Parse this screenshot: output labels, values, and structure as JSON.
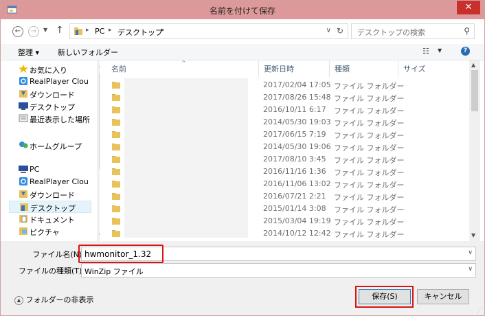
{
  "window": {
    "title": "名前を付けて保存",
    "close": "✕"
  },
  "address": {
    "root": "PC",
    "current": "デスクトップ"
  },
  "search": {
    "placeholder": "デスクトップの検索"
  },
  "toolbar": {
    "organize": "整理 ▾",
    "new_folder": "新しいフォルダー"
  },
  "nav": {
    "items": [
      {
        "label": "お気に入り",
        "icon": "star-icon"
      },
      {
        "label": "RealPlayer Clou",
        "icon": "realplayer-icon"
      },
      {
        "label": "ダウンロード",
        "icon": "download-icon"
      },
      {
        "label": "デスクトップ",
        "icon": "desktop-icon"
      },
      {
        "label": "最近表示した場所",
        "icon": "recent-icon"
      },
      {
        "label": "ホームグループ",
        "icon": "homegroup-icon"
      },
      {
        "label": "PC",
        "icon": "pc-icon"
      },
      {
        "label": "RealPlayer Clou",
        "icon": "realplayer-icon"
      },
      {
        "label": "ダウンロード",
        "icon": "download-icon"
      },
      {
        "label": "デスクトップ",
        "icon": "desktop-icon"
      },
      {
        "label": "ドキュメント",
        "icon": "document-icon"
      },
      {
        "label": "ピクチャ",
        "icon": "picture-icon"
      }
    ]
  },
  "columns": {
    "name": "名前",
    "date": "更新日時",
    "type": "種類",
    "size": "サイズ"
  },
  "files": [
    {
      "date": "2017/02/04 17:05",
      "type": "ファイル フォルダー"
    },
    {
      "date": "2017/08/26 15:48",
      "type": "ファイル フォルダー"
    },
    {
      "date": "2016/10/11 6:17",
      "type": "ファイル フォルダー"
    },
    {
      "date": "2014/05/30 19:03",
      "type": "ファイル フォルダー"
    },
    {
      "date": "2017/06/15 7:19",
      "type": "ファイル フォルダー"
    },
    {
      "date": "2014/05/30 19:06",
      "type": "ファイル フォルダー"
    },
    {
      "date": "2017/08/10 3:45",
      "type": "ファイル フォルダー"
    },
    {
      "date": "2016/11/16 1:36",
      "type": "ファイル フォルダー"
    },
    {
      "date": "2016/11/06 13:02",
      "type": "ファイル フォルダー"
    },
    {
      "date": "2016/07/21 2:21",
      "type": "ファイル フォルダー"
    },
    {
      "date": "2015/01/14 3:08",
      "type": "ファイル フォルダー"
    },
    {
      "date": "2015/03/04 19:19",
      "type": "ファイル フォルダー"
    },
    {
      "date": "2014/10/12 12:42",
      "type": "ファイル フォルダー"
    }
  ],
  "form": {
    "filename_label": "ファイル名(N):",
    "filename_value": "hwmonitor_1.32",
    "filetype_label": "ファイルの種類(T):",
    "filetype_value": "WinZip ファイル"
  },
  "footer": {
    "hide_folders": "フォルダーの非表示",
    "save": "保存(S)",
    "cancel": "キャンセル"
  },
  "colors": {
    "titlebar": "#dd9999",
    "close": "#c9302c",
    "highlight": "#dd1111",
    "folder": "#e8c25a"
  }
}
